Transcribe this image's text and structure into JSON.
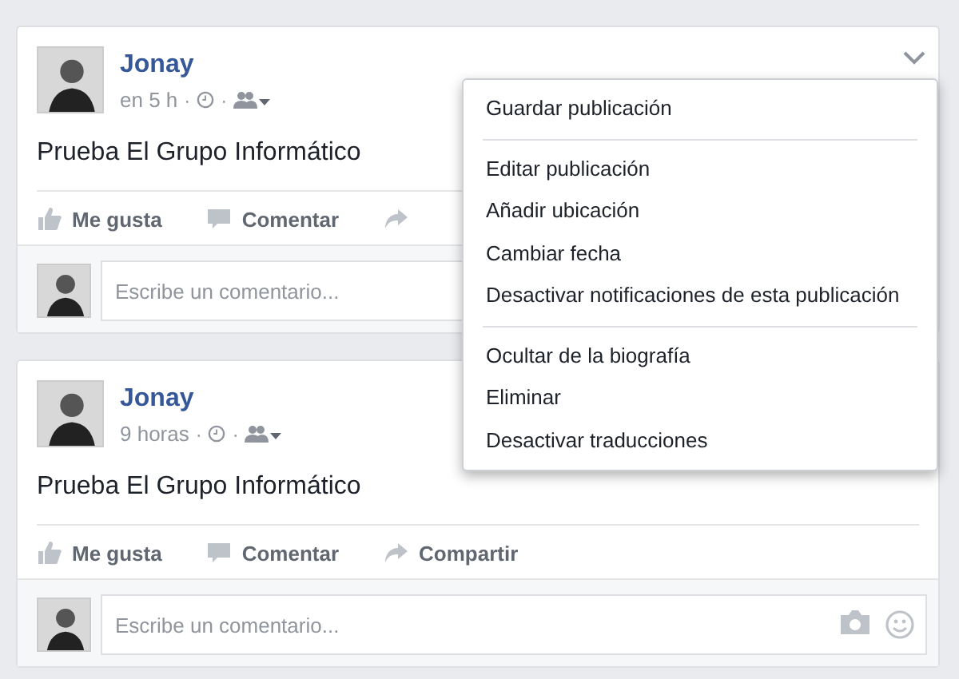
{
  "posts": [
    {
      "author": "Jonay",
      "time": "en 5 h",
      "separator": "·",
      "text": "Prueba El Grupo Informático",
      "actions": [
        {
          "kind": "like",
          "label": "Me gusta"
        },
        {
          "kind": "comment",
          "label": "Comentar"
        },
        {
          "kind": "share"
        }
      ],
      "comment_placeholder": "Escribe un comentario...",
      "menu_open": true
    },
    {
      "author": "Jonay",
      "time": "9 horas",
      "separator": "·",
      "text": "Prueba El Grupo Informático",
      "actions": [
        {
          "kind": "like",
          "label": "Me gusta"
        },
        {
          "kind": "comment",
          "label": "Comentar"
        },
        {
          "kind": "share",
          "label": "Compartir"
        }
      ],
      "comment_placeholder": "Escribe un comentario...",
      "menu_open": false
    }
  ],
  "menu": {
    "groups": [
      [
        "Guardar publicación"
      ],
      [
        "Editar publicación",
        "Añadir ubicación",
        "Cambiar fecha",
        "Desactivar notificaciones de esta publicación"
      ],
      [
        "Ocultar de la biografía",
        "Eliminar",
        "Desactivar traducciones"
      ]
    ]
  }
}
